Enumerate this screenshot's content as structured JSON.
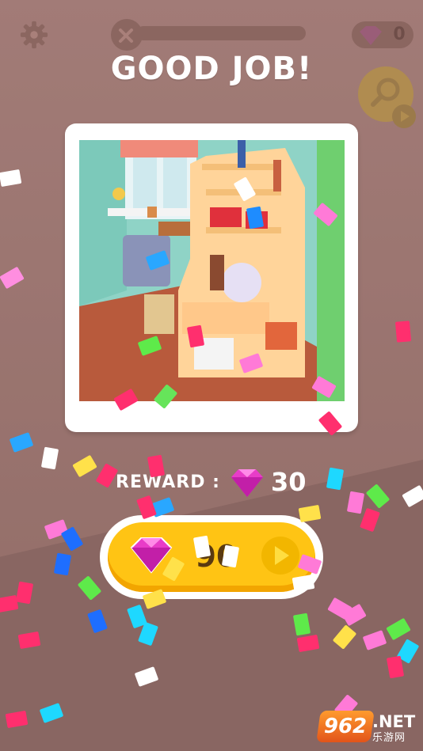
{
  "hud": {
    "gem_count": "0",
    "icons": [
      "gear-icon",
      "wrench-icon",
      "gem-icon",
      "magnifier-icon",
      "play-icon"
    ]
  },
  "title": "GOOD JOB!",
  "reward": {
    "label": "REWARD :",
    "value": "30"
  },
  "claim": {
    "value": "90"
  },
  "watermark": {
    "number": "962",
    "net": ".NET",
    "cn": "乐游网"
  },
  "colors": {
    "accent_yellow": "#ffc414",
    "gem_pink": "#e83cc8",
    "background": "#a9807a"
  }
}
